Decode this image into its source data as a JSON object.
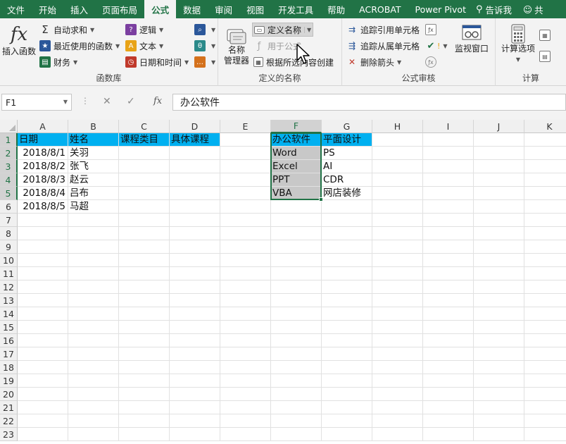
{
  "menu": {
    "tabs": [
      "文件",
      "开始",
      "插入",
      "页面布局",
      "公式",
      "数据",
      "审阅",
      "视图",
      "开发工具",
      "帮助",
      "ACROBAT",
      "Power Pivot"
    ],
    "active_tab": "公式",
    "tell_me": "告诉我",
    "user_label": "共"
  },
  "ribbon": {
    "function_library": {
      "label": "函数库",
      "insert_function": "插入函数",
      "autosum": "自动求和",
      "recent": "最近使用的函数",
      "financial": "财务",
      "logical": "逻辑",
      "text": "文本",
      "datetime": "日期和时间"
    },
    "defined_names": {
      "label": "定义的名称",
      "name_manager_line1": "名称",
      "name_manager_line2": "管理器",
      "define_name": "定义名称",
      "use_in_formula": "用于公式",
      "create_from_selection": "根据所选内容创建"
    },
    "formula_auditing": {
      "label": "公式审核",
      "trace_precedents": "追踪引用单元格",
      "trace_dependents": "追踪从属单元格",
      "remove_arrows": "删除箭头",
      "watch_window": "监视窗口"
    },
    "calculation": {
      "label": "计算",
      "calc_options": "计算选项"
    }
  },
  "formula_bar": {
    "name_box": "F1",
    "content": "办公软件"
  },
  "columns": [
    "A",
    "B",
    "C",
    "D",
    "E",
    "F",
    "G",
    "H",
    "I",
    "J",
    "K"
  ],
  "selected_column": "F",
  "rows": [
    "1",
    "2",
    "3",
    "4",
    "5",
    "6",
    "7",
    "8",
    "9",
    "10",
    "11",
    "12",
    "13",
    "14",
    "15",
    "16",
    "17",
    "18",
    "19",
    "20",
    "21",
    "22",
    "23"
  ],
  "selected_rows": [
    "1",
    "2",
    "3",
    "4",
    "5"
  ],
  "cells": {
    "A1": "日期",
    "B1": "姓名",
    "C1": "课程类目",
    "D1": "具体课程",
    "A2": "2018/8/1",
    "B2": "关羽",
    "A3": "2018/8/2",
    "B3": "张飞",
    "A4": "2018/8/3",
    "B4": "赵云",
    "A5": "2018/8/4",
    "B5": "吕布",
    "A6": "2018/8/5",
    "B6": "马超",
    "F1": "办公软件",
    "G1": "平面设计",
    "F2": "Word",
    "G2": "PS",
    "F3": "Excel",
    "G3": "AI",
    "F4": "PPT",
    "G4": "CDR",
    "F5": "VBA",
    "G5": "网店装修"
  },
  "colors": {
    "excel_green": "#217346",
    "header_fill": "#00b0f0",
    "selection_fill": "#c8c8c8"
  }
}
